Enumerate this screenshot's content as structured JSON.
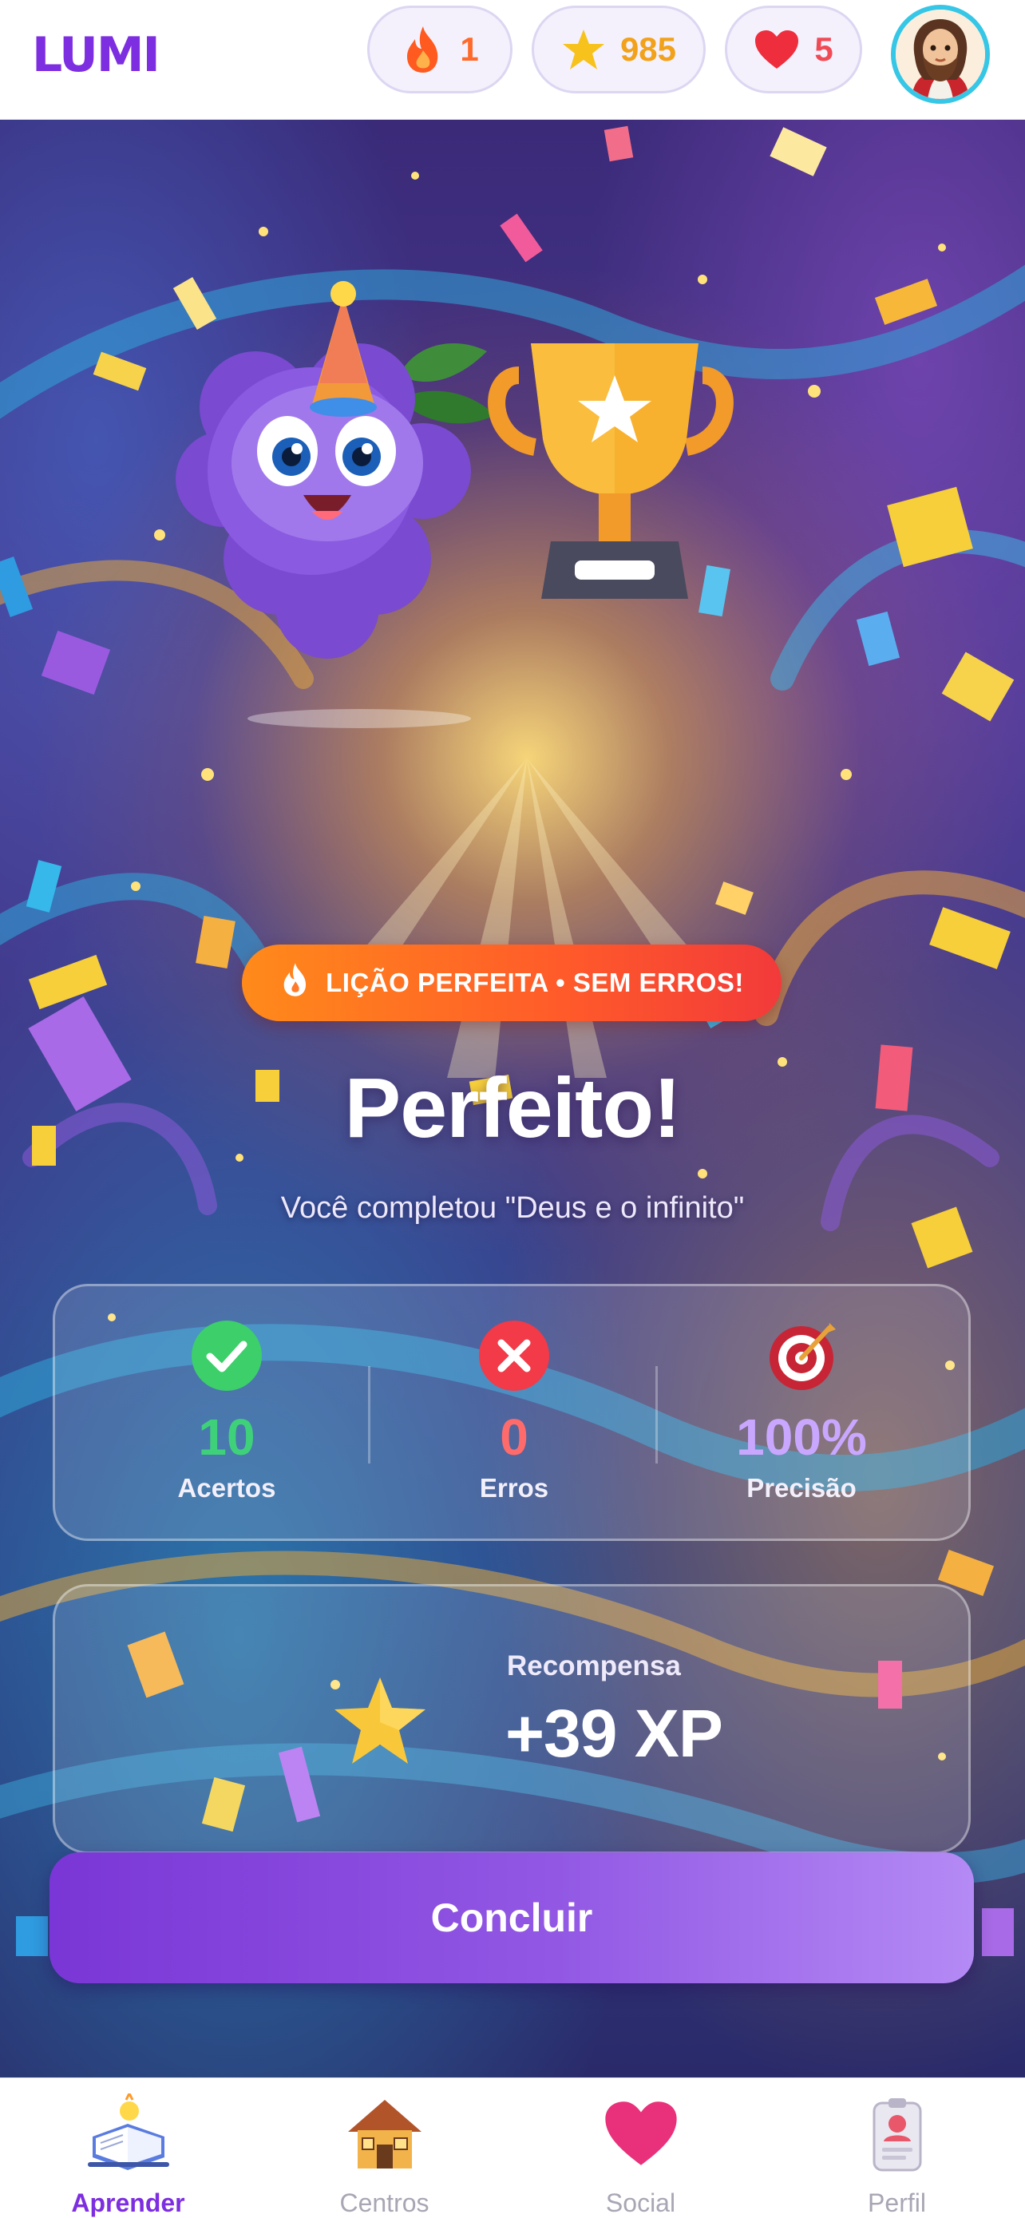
{
  "app": {
    "logo": "LUMI"
  },
  "header": {
    "streak": {
      "value": "1",
      "icon": "flame-icon"
    },
    "stars": {
      "value": "985",
      "icon": "star-icon"
    },
    "hearts": {
      "value": "5",
      "icon": "heart-icon"
    },
    "avatar": {
      "icon": "user-avatar"
    }
  },
  "result": {
    "badge": "LIÇÃO PERFEITA • SEM ERROS!",
    "title": "Perfeito!",
    "subtitle": "Você completou \"Deus e o infinito\""
  },
  "stats": [
    {
      "value": "10",
      "label": "Acertos",
      "color": "#3fd17a",
      "icon": "check-circle-icon"
    },
    {
      "value": "0",
      "label": "Erros",
      "color": "#ff6b6b",
      "icon": "x-circle-icon"
    },
    {
      "value": "100%",
      "label": "Precisão",
      "color": "#c9a7ff",
      "icon": "target-icon"
    }
  ],
  "reward": {
    "label": "Recompensa",
    "value": "+39 XP",
    "icon": "star-icon"
  },
  "button": {
    "label": "Concluir"
  },
  "nav": [
    {
      "label": "Aprender",
      "icon": "book-icon",
      "active": true
    },
    {
      "label": "Centros",
      "icon": "house-icon",
      "active": false
    },
    {
      "label": "Social",
      "icon": "heart-icon",
      "active": false
    },
    {
      "label": "Perfil",
      "icon": "profile-card-icon",
      "active": false
    }
  ],
  "colors": {
    "brand": "#7d2ee0",
    "streak": "#ff6a2b",
    "stars": "#f2a11a",
    "hearts": "#f04a55",
    "avatar_ring": "#36c6e6"
  }
}
